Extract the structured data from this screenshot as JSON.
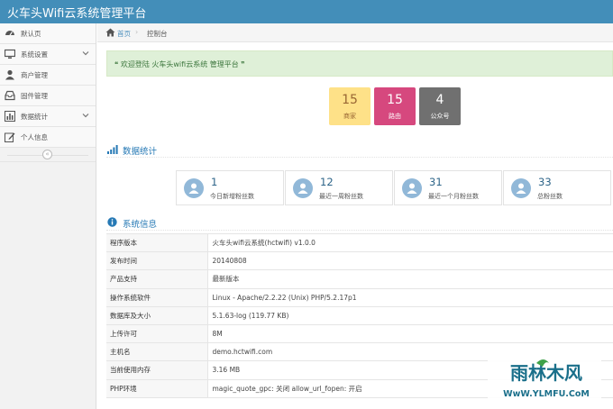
{
  "header": {
    "brand": "火车头Wifi云系统管理平台",
    "bg_color": "#438eb9"
  },
  "sidebar": {
    "items": [
      {
        "label": "默认页",
        "icon": "dashboard-icon",
        "has_children": false
      },
      {
        "label": "系统设置",
        "icon": "monitor-icon",
        "has_children": true
      },
      {
        "label": "商户管理",
        "icon": "user-icon",
        "has_children": false
      },
      {
        "label": "固件管理",
        "icon": "inbox-icon",
        "has_children": false
      },
      {
        "label": "数据统计",
        "icon": "bar-chart-icon",
        "has_children": true
      },
      {
        "label": "个人信息",
        "icon": "edit-icon",
        "has_children": false
      }
    ],
    "collapse_icon": "double-angle-left-icon"
  },
  "breadcrumb": {
    "home": "首页",
    "separator": "›",
    "current": "控制台"
  },
  "welcome": {
    "text": "❝ 欢迎登陆 火车头wifi云系统 管理平台 ❞"
  },
  "tiles": [
    {
      "value": "15",
      "label": "商家",
      "bg": "#fee188",
      "fg": "#963"
    },
    {
      "value": "15",
      "label": "路由",
      "bg": "#d6487e",
      "fg": "#ffffff"
    },
    {
      "value": "4",
      "label": "公众号",
      "bg": "#707070",
      "fg": "#ffffff"
    }
  ],
  "stats_section": {
    "title": "数据统计",
    "icon": "signal-icon"
  },
  "stats": [
    {
      "value": "1",
      "label": "今日新增粉丝数",
      "icon": "user-avatar-icon"
    },
    {
      "value": "12",
      "label": "最近一周粉丝数",
      "icon": "user-avatar-icon"
    },
    {
      "value": "31",
      "label": "最近一个月粉丝数",
      "icon": "user-avatar-icon"
    },
    {
      "value": "33",
      "label": "总粉丝数",
      "icon": "user-avatar-icon"
    }
  ],
  "system_section": {
    "title": "系统信息",
    "icon": "info-circle-icon"
  },
  "system_info": [
    {
      "key": "程序版本",
      "value": "火车头wifi云系统(hctwifi) v1.0.0"
    },
    {
      "key": "发布时间",
      "value": "20140808"
    },
    {
      "key": "产品支持",
      "value": "最新版本"
    },
    {
      "key": "操作系统软件",
      "value": "Linux - Apache/2.2.22 (Unix) PHP/5.2.17p1"
    },
    {
      "key": "数据库及大小",
      "value": "5.1.63-log (119.77 KB)"
    },
    {
      "key": "上传许可",
      "value": "8M"
    },
    {
      "key": "主机名",
      "value": "demo.hctwifi.com"
    },
    {
      "key": "当前使用内存",
      "value": "3.16 MB"
    },
    {
      "key": "PHP环境",
      "value": "magic_quote_gpc: 关闭    allow_url_fopen: 开启"
    }
  ],
  "watermark": {
    "brand": "雨林木风",
    "url": "WwW.YLMFU.CoM"
  }
}
